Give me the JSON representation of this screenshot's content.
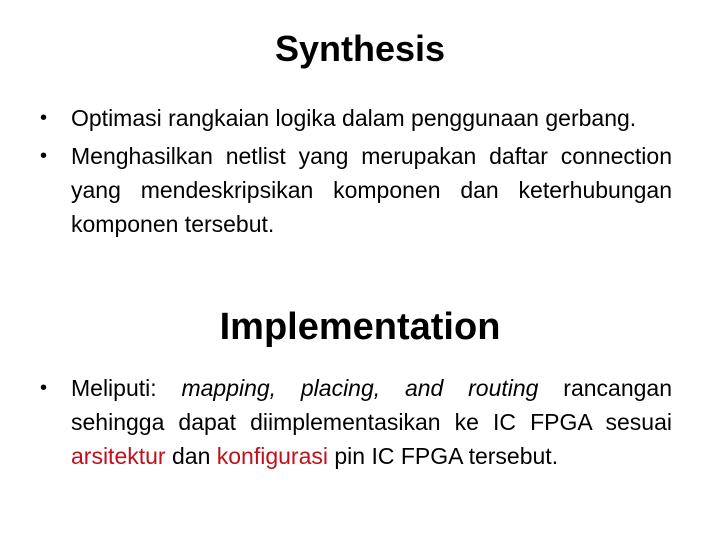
{
  "slide": {
    "section1": {
      "title": "Synthesis",
      "bullets": [
        "Optimasi rangkaian logika dalam penggunaan gerbang.",
        "Menghasilkan netlist yang merupakan daftar connection yang mendeskripsikan komponen dan keterhubungan komponen tersebut."
      ]
    },
    "section2": {
      "title": "Implementation",
      "bullet": {
        "prefix": "Meliputi: ",
        "italic": "mapping, placing, and routing",
        "middle": " rancangan sehingga dapat diimplementasikan ke IC FPGA sesuai ",
        "highlight1": "arsitektur",
        "between": " dan ",
        "highlight2": "konfigurasi",
        "suffix": " pin IC FPGA tersebut."
      },
      "highlight_color": "#c0101a"
    }
  }
}
